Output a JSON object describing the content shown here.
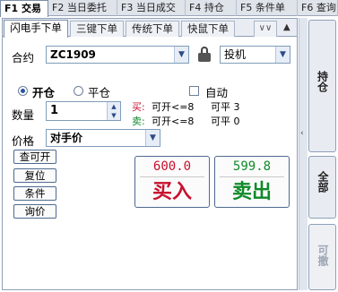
{
  "ftabs": [
    {
      "label": "F1 交易"
    },
    {
      "label": "F2 当日委托"
    },
    {
      "label": "F3 当日成交"
    },
    {
      "label": "F4 持仓"
    },
    {
      "label": "F5 条件单"
    },
    {
      "label": "F6 查询"
    }
  ],
  "subtabs": [
    {
      "label": "闪电手下单"
    },
    {
      "label": "三键下单"
    },
    {
      "label": "传统下单"
    },
    {
      "label": "快鼠下单"
    }
  ],
  "subtabs_more_icon": "chevron-down-icon",
  "form": {
    "contract_label": "合约",
    "contract_value": "ZC1909",
    "lock_icon": "lock-icon",
    "hedge_value": "投机",
    "open_label": "开仓",
    "close_label": "平仓",
    "auto_label": "自动",
    "auto_checked": false,
    "open_selected": true,
    "qty_label": "数量",
    "qty_value": "1",
    "buy_prefix": "买:",
    "buy_can_open": "可开<=8",
    "buy_can_close": "可平 3",
    "sell_prefix": "卖:",
    "sell_can_open": "可开<=8",
    "sell_can_close": "可平 0",
    "price_label": "价格",
    "price_value": "对手价"
  },
  "side_buttons": [
    "查可开",
    "复位",
    "条件",
    "询价"
  ],
  "buy_button": {
    "price": "600.0",
    "label": "买入",
    "color": "#c8102e"
  },
  "sell_button": {
    "price": "599.8",
    "label": "卖出",
    "color": "#108a2a"
  },
  "right_panel": {
    "collapse_icon": "chevron-left-icon",
    "buttons": [
      {
        "label": "持仓",
        "enabled": true
      },
      {
        "label": "全部",
        "enabled": true
      },
      {
        "label": "可撤",
        "enabled": false
      }
    ]
  }
}
